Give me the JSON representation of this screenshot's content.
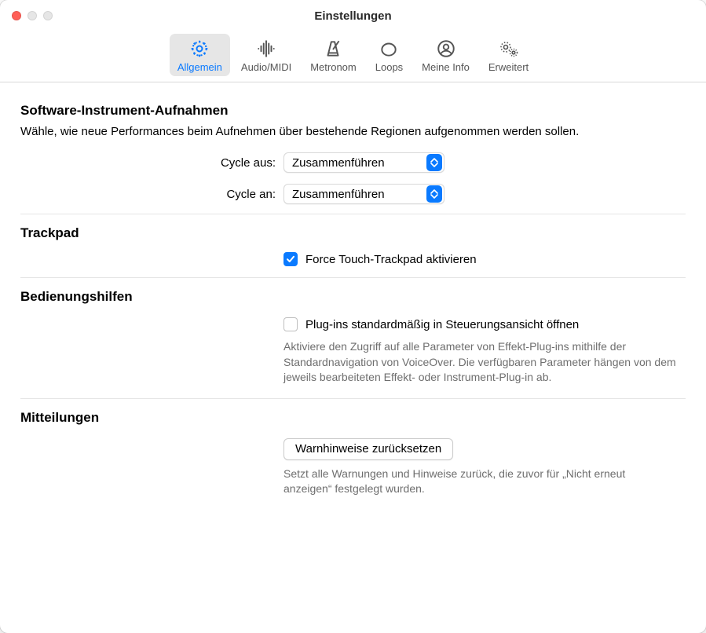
{
  "window": {
    "title": "Einstellungen"
  },
  "toolbar": {
    "items": [
      {
        "label": "Allgemein"
      },
      {
        "label": "Audio/MIDI"
      },
      {
        "label": "Metronom"
      },
      {
        "label": "Loops"
      },
      {
        "label": "Meine Info"
      },
      {
        "label": "Erweitert"
      }
    ]
  },
  "sections": {
    "software_instrument": {
      "heading": "Software-Instrument-Aufnahmen",
      "description": "Wähle, wie neue Performances beim Aufnehmen über bestehende Regionen aufgenommen werden sollen.",
      "cycle_off": {
        "label": "Cycle aus:",
        "value": "Zusammenführen"
      },
      "cycle_on": {
        "label": "Cycle an:",
        "value": "Zusammenführen"
      }
    },
    "trackpad": {
      "heading": "Trackpad",
      "checkbox": {
        "label": "Force Touch-Trackpad aktivieren",
        "checked": true
      }
    },
    "accessibility": {
      "heading": "Bedienungshilfen",
      "checkbox": {
        "label": "Plug-ins standardmäßig in Steuerungsansicht öffnen",
        "checked": false
      },
      "help": "Aktiviere den Zugriff auf alle Parameter von Effekt-Plug-ins mithilfe der Standardnavigation von VoiceOver. Die verfügbaren Parameter hängen von dem jeweils bearbeiteten Effekt- oder Instrument-Plug-in ab."
    },
    "notifications": {
      "heading": "Mitteilungen",
      "button": "Warnhinweise zurücksetzen",
      "help": "Setzt alle Warnungen und Hinweise zurück, die zuvor für „Nicht erneut anzeigen“ festgelegt wurden."
    }
  }
}
